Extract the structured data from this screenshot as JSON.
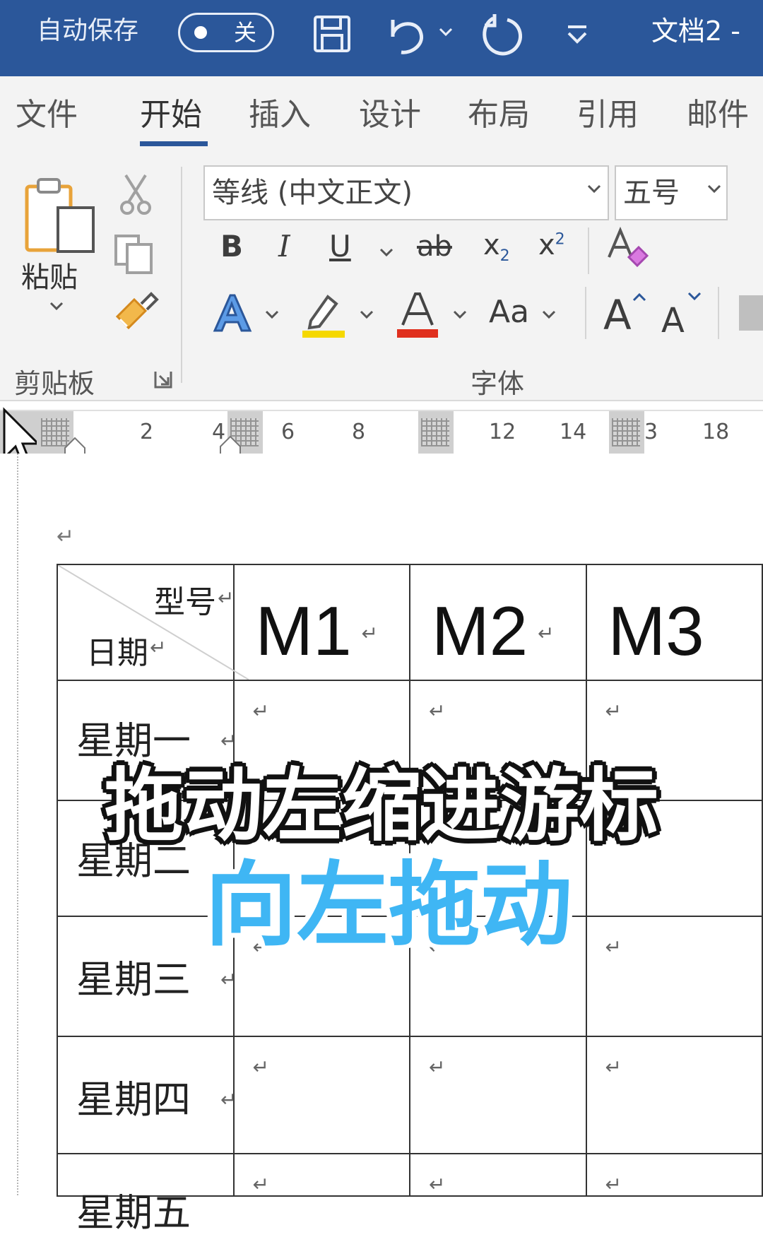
{
  "title_bar": {
    "autosave_label": "自动保存",
    "autosave_state": "关",
    "document_name": "文档2 -",
    "icons": [
      "save-icon",
      "undo-icon",
      "redo-icon",
      "customize-quick-access-icon"
    ]
  },
  "tabs": [
    {
      "label": "文件",
      "active": false
    },
    {
      "label": "开始",
      "active": true
    },
    {
      "label": "插入",
      "active": false
    },
    {
      "label": "设计",
      "active": false
    },
    {
      "label": "布局",
      "active": false
    },
    {
      "label": "引用",
      "active": false
    },
    {
      "label": "邮件",
      "active": false
    }
  ],
  "clipboard": {
    "paste_label": "粘贴",
    "group_label": "剪贴板",
    "icons": [
      "cut-icon",
      "copy-icon",
      "format-painter-icon",
      "dialog-launcher-icon"
    ]
  },
  "font": {
    "font_name": "等线 (中文正文)",
    "font_size": "五号",
    "group_label": "字体",
    "bold": "B",
    "italic": "I",
    "underline": "U",
    "strikethrough": "ab",
    "subscript": "x",
    "subscript_sub": "2",
    "superscript": "x",
    "superscript_sup": "2",
    "change_case": "Aa",
    "grow_font": "A",
    "shrink_font": "A",
    "text_effect": "A",
    "font_color": "A",
    "highlight_color": "#f5d800",
    "font_color_bar": "#e0301e",
    "accent": "#2b579a"
  },
  "ruler": {
    "numbers": [
      "2",
      "4",
      "6",
      "8",
      "12",
      "14",
      "3",
      "18"
    ]
  },
  "table": {
    "header_top": "型号",
    "header_bottom": "日期",
    "models": [
      "M1",
      "M2",
      "M3"
    ],
    "rows": [
      "星期一",
      "星期二",
      "星期三",
      "星期四",
      "星期五"
    ]
  },
  "paragraph_mark": "↵",
  "caption": {
    "line1": "拖动左缩进游标",
    "line2": "向左拖动"
  }
}
